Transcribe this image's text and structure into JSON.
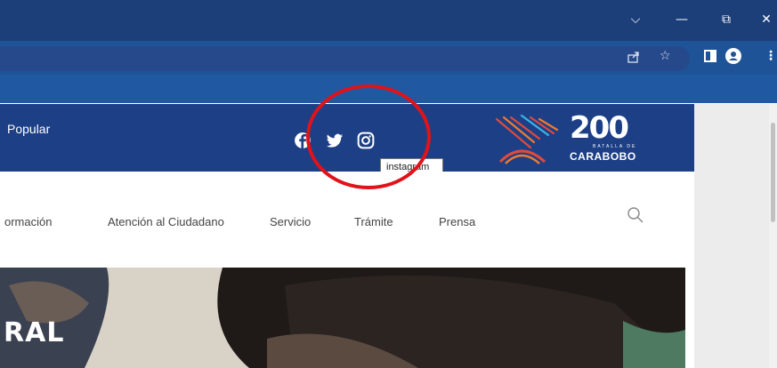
{
  "browser": {
    "window_controls": {
      "collapse": "⌵",
      "minimize": "—",
      "restore": "⧉",
      "close": "✕"
    },
    "toolbar_icons": [
      "share-icon",
      "star-icon",
      "sidepanel-icon",
      "profile-icon",
      "menu-icon"
    ]
  },
  "site": {
    "header_left_text": "Popular",
    "social": [
      "facebook-icon",
      "twitter-icon",
      "instagram-icon"
    ],
    "tooltip": "instagram",
    "logo": {
      "number": "200",
      "line1": "BATALLA DE",
      "line2": "CARABOBO"
    },
    "nav": [
      "ormación",
      "Atención al Ciudadano",
      "Servicio",
      "Trámite",
      "Prensa"
    ],
    "hero_text": "RAL"
  },
  "colors": {
    "header_blue": "#1d3f86",
    "annotation_red": "#e0131a"
  }
}
